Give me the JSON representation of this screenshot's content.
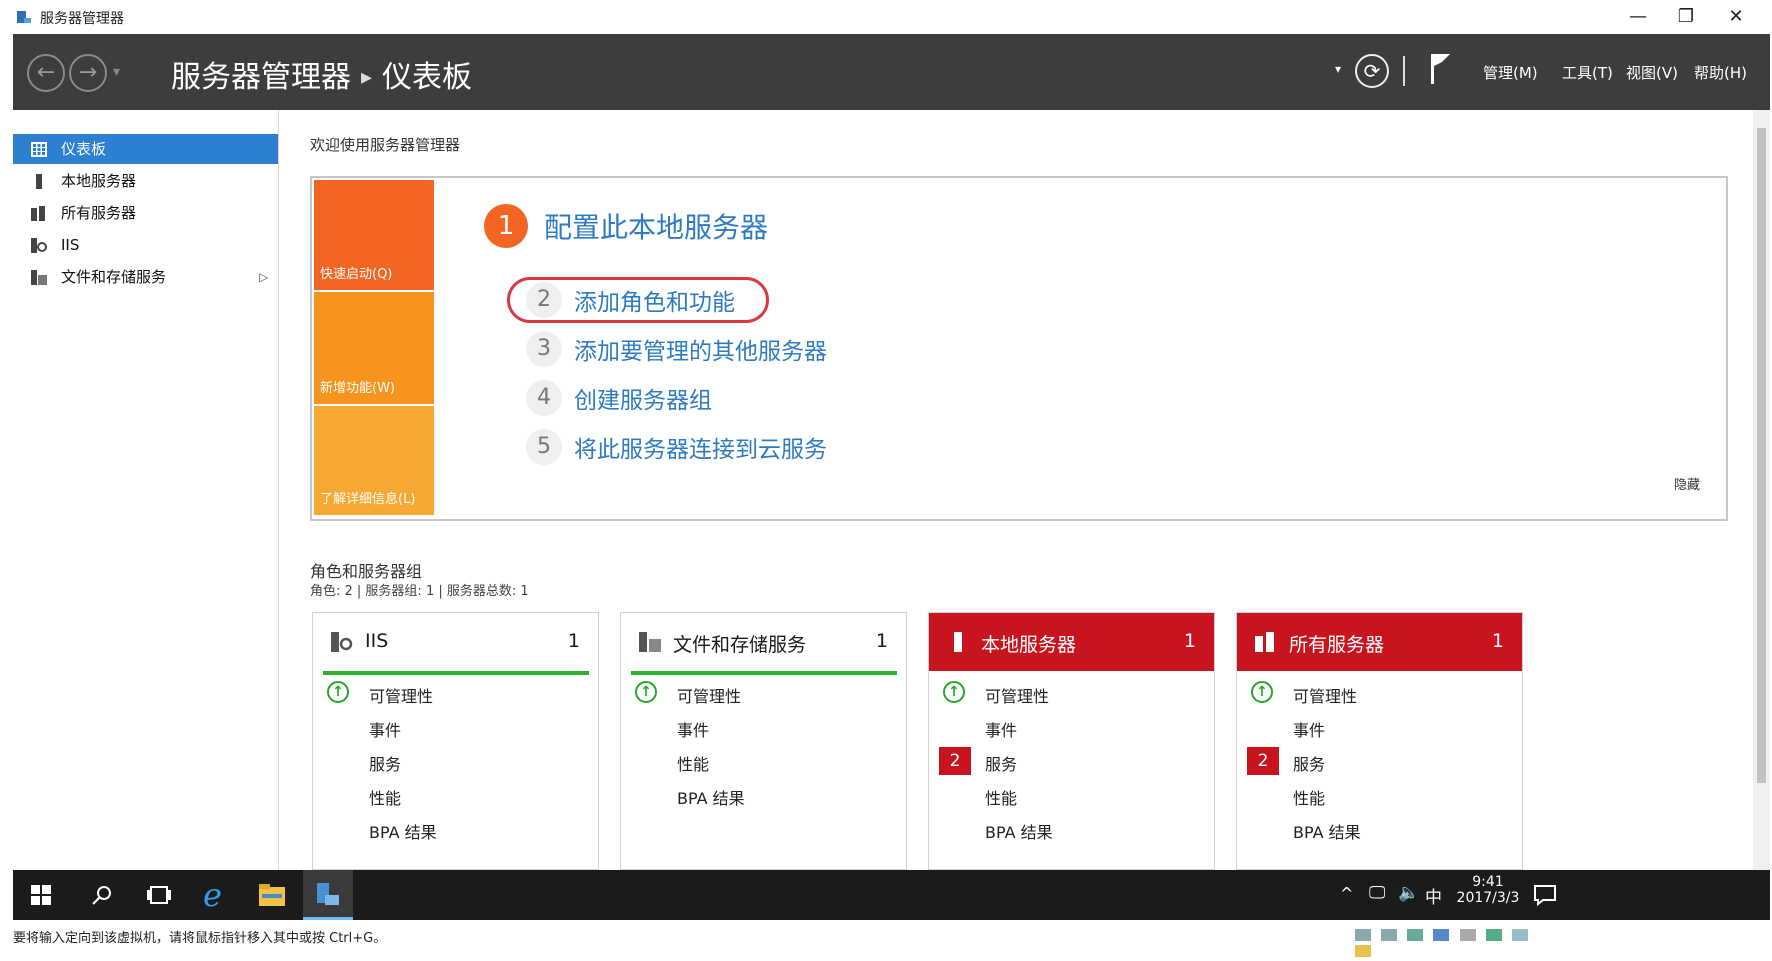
{
  "window": {
    "title": "服务器管理器",
    "minimize": "—",
    "restore": "❐",
    "close": "✕"
  },
  "header": {
    "breadcrumb_root": "服务器管理器",
    "breadcrumb_sep": "▸",
    "breadcrumb_page": "仪表板",
    "back": "←",
    "forward": "→",
    "refresh": "⟳",
    "menus": [
      "管理(M)",
      "工具(T)",
      "视图(V)",
      "帮助(H)"
    ]
  },
  "sidebar": {
    "items": [
      {
        "label": "仪表板",
        "active": true
      },
      {
        "label": "本地服务器"
      },
      {
        "label": "所有服务器"
      },
      {
        "label": "IIS"
      },
      {
        "label": "文件和存储服务",
        "has_arrow": true
      }
    ],
    "arrow": "▷"
  },
  "welcome": {
    "heading": "欢迎使用服务器管理器",
    "quick_start": "快速启动(Q)",
    "whats_new": "新增功能(W)",
    "learn_more": "了解详细信息(L)",
    "hide": "隐藏",
    "steps": [
      {
        "num": "1",
        "text": "配置此本地服务器"
      },
      {
        "num": "2",
        "text": "添加角色和功能"
      },
      {
        "num": "3",
        "text": "添加要管理的其他服务器"
      },
      {
        "num": "4",
        "text": "创建服务器组"
      },
      {
        "num": "5",
        "text": "将此服务器连接到云服务"
      }
    ],
    "colors": {
      "quick_start": "#f26522",
      "whats_new": "#f7941e",
      "learn_more": "#f7a833"
    }
  },
  "roles": {
    "heading": "角色和服务器组",
    "summary": "角色: 2 | 服务器组: 1 | 服务器总数: 1"
  },
  "tiles": [
    {
      "title": "IIS",
      "count": "1",
      "status": "ok",
      "rows": [
        {
          "label": "可管理性",
          "ok": true
        },
        {
          "label": "事件"
        },
        {
          "label": "服务"
        },
        {
          "label": "性能"
        },
        {
          "label": "BPA 结果"
        }
      ]
    },
    {
      "title": "文件和存储服务",
      "count": "1",
      "status": "ok",
      "rows": [
        {
          "label": "可管理性",
          "ok": true
        },
        {
          "label": "事件"
        },
        {
          "label": "性能"
        },
        {
          "label": "BPA 结果"
        }
      ]
    },
    {
      "title": "本地服务器",
      "count": "1",
      "status": "error",
      "rows": [
        {
          "label": "可管理性",
          "ok": true
        },
        {
          "label": "事件"
        },
        {
          "label": "服务",
          "badge": "2"
        },
        {
          "label": "性能"
        },
        {
          "label": "BPA 结果"
        }
      ]
    },
    {
      "title": "所有服务器",
      "count": "1",
      "status": "error",
      "rows": [
        {
          "label": "可管理性",
          "ok": true
        },
        {
          "label": "事件"
        },
        {
          "label": "服务",
          "badge": "2"
        },
        {
          "label": "性能"
        },
        {
          "label": "BPA 结果"
        }
      ]
    }
  ],
  "taskbar": {
    "time": "9:41",
    "date": "2017/3/3",
    "ime": "中",
    "icons": [
      "start-icon",
      "search-icon",
      "task-view-icon",
      "ie-icon",
      "file-explorer-icon",
      "server-manager-icon"
    ]
  },
  "statusbar": {
    "text": "要将输入定向到该虚拟机，请将鼠标指针移入其中或按 Ctrl+G。"
  }
}
